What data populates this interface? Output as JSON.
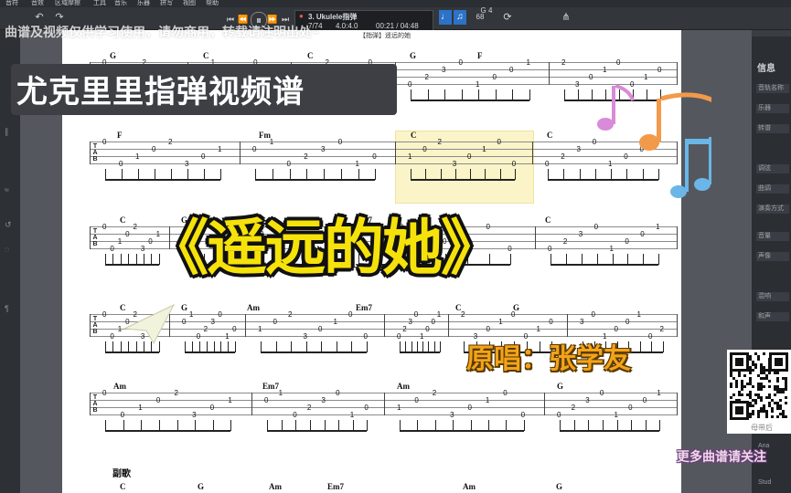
{
  "menubar": {
    "items": [
      "音符",
      "音效",
      "区域摩擦",
      "工具",
      "音乐",
      "乐器",
      "拼写",
      "视图",
      "帮助"
    ]
  },
  "toolbar": {
    "undo_icon": "undo-icon",
    "redo_icon": "redo-icon",
    "track_name": "3. Ukulele指弹",
    "position": "7/74",
    "time_signature": "4.0:4.0",
    "time": "00:21 / 04:48",
    "tempo": "68",
    "key": "G 4"
  },
  "score": {
    "page_header": "【指弹】遥远的她",
    "highlight_color": "#fbf4c8",
    "section_label": "副歌",
    "rows": [
      {
        "chords": [
          "G",
          "C",
          "C",
          "G",
          "F"
        ],
        "chord_x": [
          120,
          222,
          336,
          448,
          522
        ]
      },
      {
        "chords": [
          "F",
          "Fm",
          "C",
          "C"
        ],
        "chord_x": [
          128,
          283,
          449,
          598
        ]
      },
      {
        "chords": [
          "C",
          "G",
          "Em7",
          "C"
        ],
        "chord_x": [
          131,
          198,
          389,
          596
        ]
      },
      {
        "chords": [
          "C",
          "G",
          "Am",
          "Em7",
          "C",
          "G"
        ],
        "chord_x": [
          131,
          198,
          270,
          389,
          498,
          561
        ]
      },
      {
        "chords": [
          "Am",
          "Em7",
          "Am",
          "G"
        ],
        "chord_x": [
          124,
          287,
          434,
          609
        ]
      },
      {
        "chords": [
          "C",
          "G",
          "Am",
          "Em7",
          "Am",
          "G"
        ],
        "chord_x": [
          131,
          216,
          294,
          358,
          506,
          608
        ]
      }
    ]
  },
  "right_panel": {
    "header": "信息",
    "items": [
      "音轨名称",
      "乐器",
      "转谱",
      "调弦",
      "曲调",
      "演奏方式",
      "音量",
      "声像",
      "混响",
      "和声",
      "Ana",
      "Stud"
    ]
  },
  "overlay": {
    "watermark": "曲谱及视频仅供学习使用，请勿商用，转载请注明出处~",
    "banner_title": "尤克里里指弹视频谱",
    "song_title": "《遥远的她》",
    "singer": "原唱：张学友",
    "more": "更多曲谱请关注",
    "qr_caption": "母带后"
  }
}
